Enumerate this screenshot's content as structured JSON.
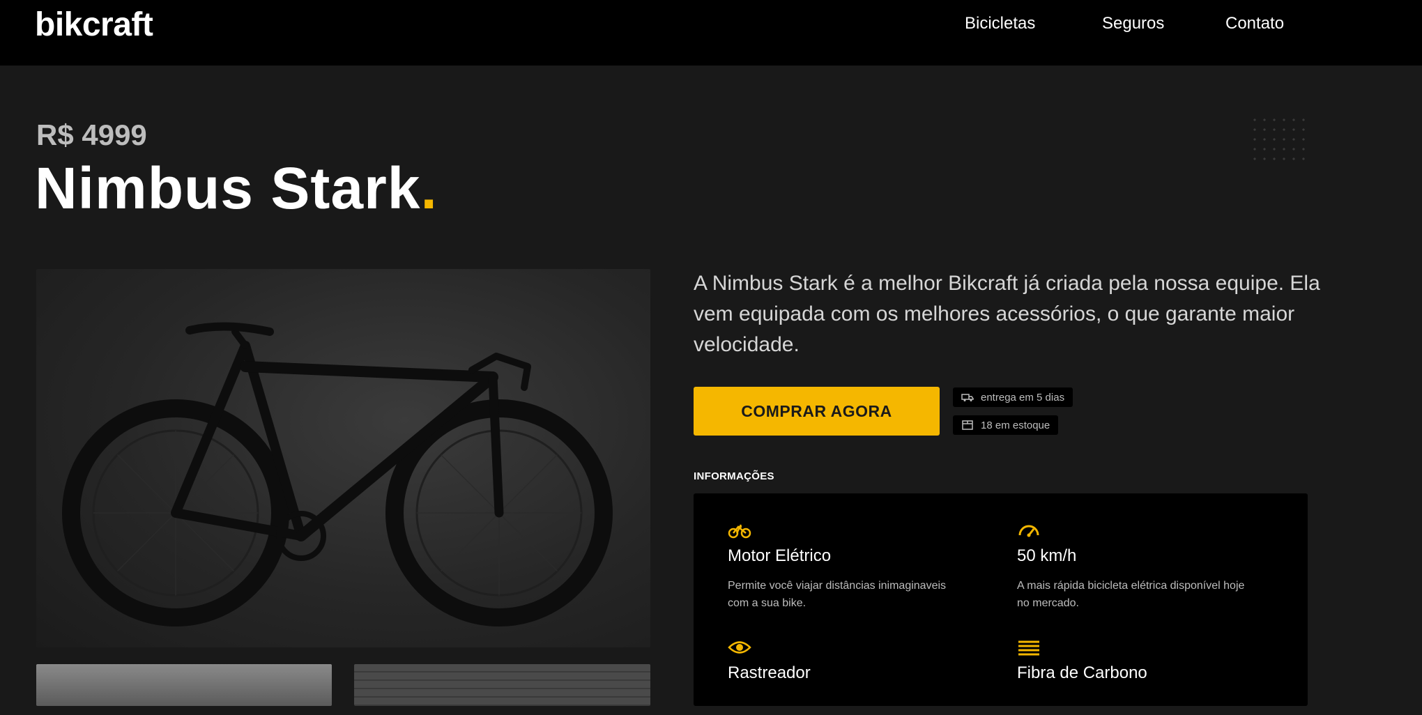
{
  "header": {
    "logo": "bikcraft",
    "nav": [
      "Bicicletas",
      "Seguros",
      "Contato"
    ]
  },
  "product": {
    "price": "R$ 4999",
    "name": "Nimbus Stark",
    "name_dot": ".",
    "description": "A Nimbus Stark é a melhor Bikcraft já criada pela nossa equipe. Ela vem equipada com os melhores acessórios, o que garante maior velocidade.",
    "buy_label": "COMPRAR AGORA",
    "delivery": "entrega em 5 dias",
    "stock": "18 em estoque"
  },
  "info": {
    "label": "INFORMAÇÕES",
    "features": [
      {
        "icon": "electric-bike-icon",
        "name": "Motor Elétrico",
        "desc": "Permite você viajar distâncias inimaginaveis com a sua bike."
      },
      {
        "icon": "speedometer-icon",
        "name": "50 km/h",
        "desc": "A mais rápida bicicleta elétrica disponível hoje no mercado."
      },
      {
        "icon": "eye-icon",
        "name": "Rastreador",
        "desc": ""
      },
      {
        "icon": "carbon-fiber-icon",
        "name": "Fibra de Carbono",
        "desc": ""
      }
    ]
  },
  "colors": {
    "accent": "#f5b700",
    "background": "#191919",
    "header": "#000000"
  }
}
